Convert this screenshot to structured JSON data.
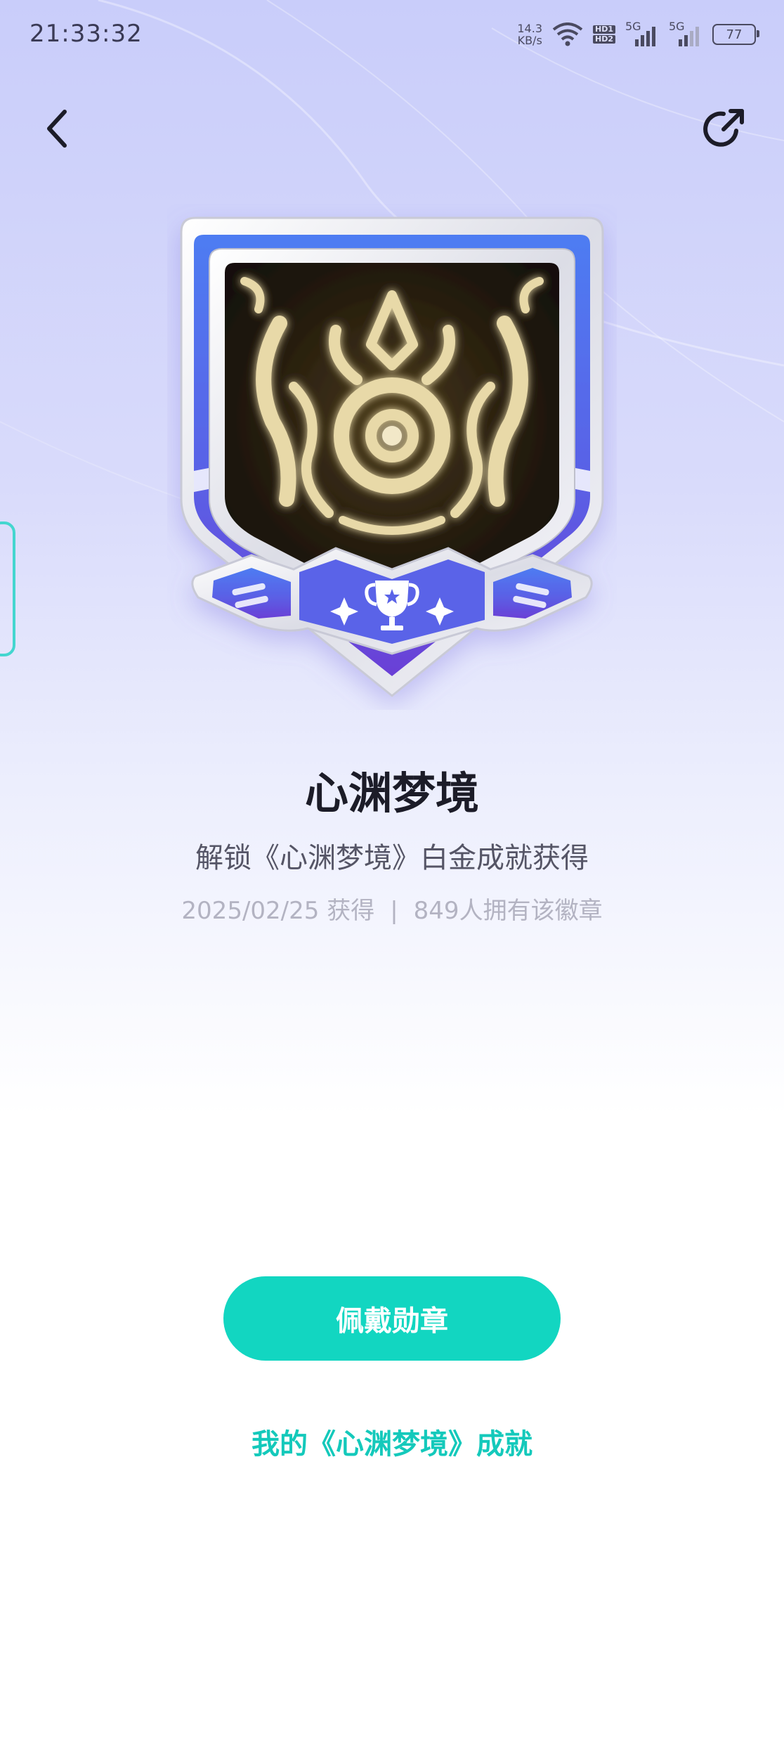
{
  "status_bar": {
    "time": "21:33:32",
    "net_speed_value": "14.3",
    "net_speed_unit": "KB/s",
    "hd1": "HD1",
    "hd2": "HD2",
    "sig1_label": "5G",
    "sig2_label": "5G",
    "battery": "77"
  },
  "nav": {
    "back_icon": "chevron-left-icon",
    "share_icon": "share-arrow-icon"
  },
  "badge": {
    "name": "心渊梦境",
    "description": "解锁《心渊梦境》白金成就获得",
    "obtained_date": "2025/02/25 获得",
    "separator": "|",
    "owners": "849人拥有该徽章",
    "icon": "trophy-icon"
  },
  "actions": {
    "wear_label": "佩戴勋章",
    "achievement_link": "我的《心渊梦境》成就"
  },
  "colors": {
    "accent": "#12d6c1",
    "badge_blue": "#4f79ef",
    "badge_purple": "#6a45d8"
  }
}
